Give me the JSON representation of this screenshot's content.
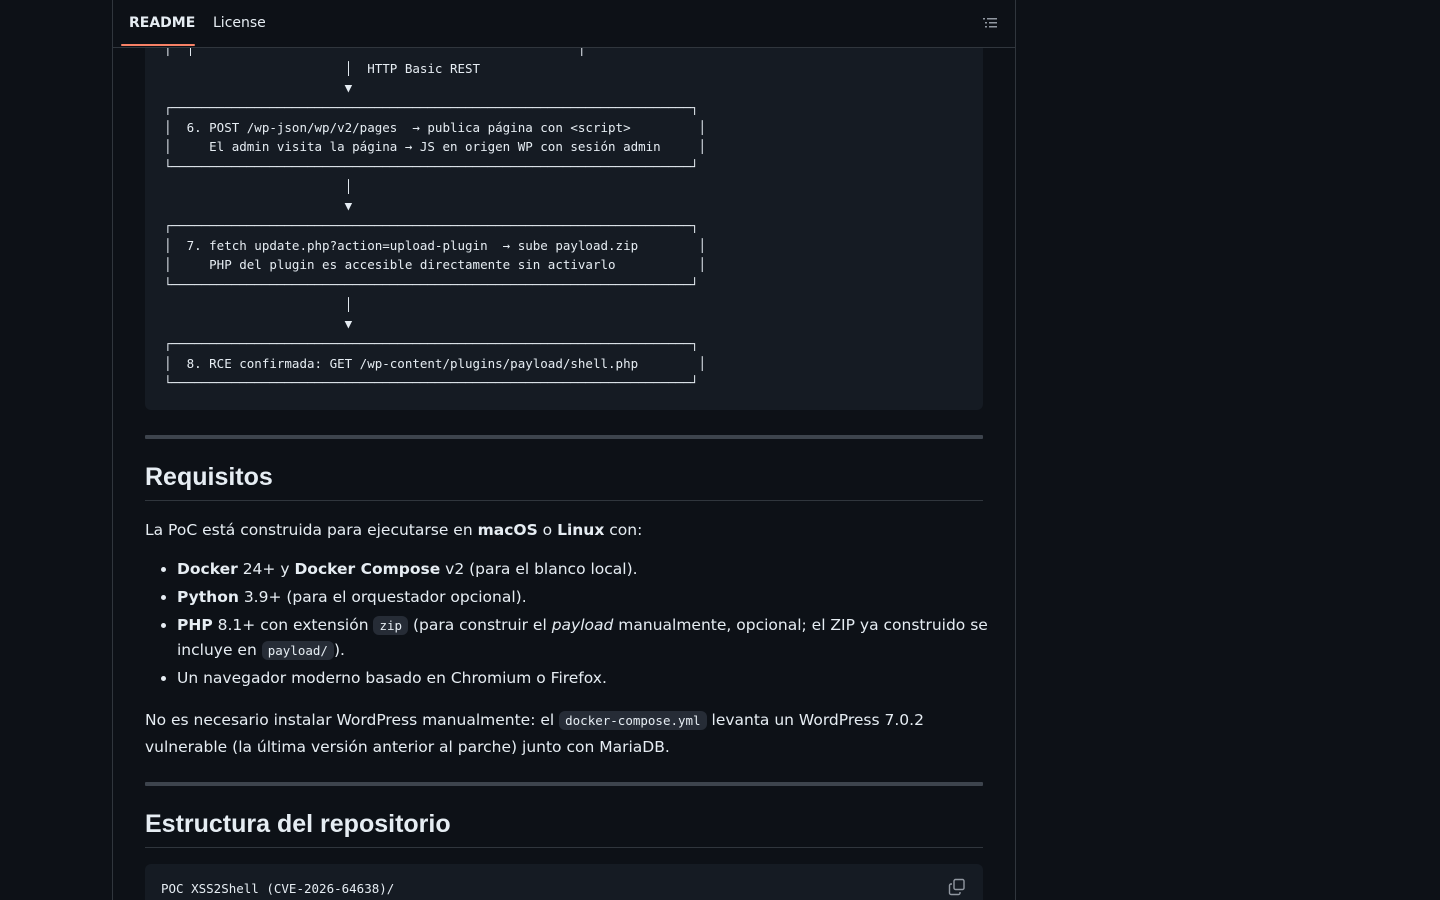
{
  "tabs": {
    "readme": "README",
    "license": "License"
  },
  "icons": {
    "outline": "list-outline-icon",
    "copy": "copy-icon"
  },
  "diagram_code": "│  │                                                   │\n                        │  HTTP Basic REST\n                        ▼\n┌─────────────────────────────────────────────────────────────────────┐\n│  6. POST /wp-json/wp/v2/pages  → publica página con <script>         │\n│     El admin visita la página → JS en origen WP con sesión admin     │\n└─────────────────────────────────────────────────────────────────────┘\n                        │\n                        ▼\n┌─────────────────────────────────────────────────────────────────────┐\n│  7. fetch update.php?action=upload-plugin  → sube payload.zip        │\n│     PHP del plugin es accesible directamente sin activarlo           │\n└─────────────────────────────────────────────────────────────────────┘\n                        │\n                        ▼\n┌─────────────────────────────────────────────────────────────────────┐\n│  8. RCE confirmada: GET /wp-content/plugins/payload/shell.php        │\n└─────────────────────────────────────────────────────────────────────┘",
  "requisitos": {
    "heading": "Requisitos",
    "intro": {
      "before": "La PoC está construida para ejecutarse en ",
      "b1": "macOS",
      "mid": " o ",
      "b2": "Linux",
      "after": " con:"
    },
    "items": [
      {
        "b1": "Docker",
        "t1": " 24+ y ",
        "b2": "Docker Compose",
        "t2": " v2 (para el blanco local)."
      },
      {
        "b1": "Python",
        "t1": " 3.9+ (para el orquestador opcional)."
      },
      {
        "b1": "PHP",
        "t1": " 8.1+ con extensión ",
        "code1": "zip",
        "t2": " (para construir el ",
        "em": "payload",
        "t3": " manualmente, opcional; el ZIP ya construido se incluye en ",
        "code2": "payload/",
        "t4": ")."
      },
      {
        "t1": "Un navegador moderno basado en Chromium o Firefox."
      }
    ],
    "note": {
      "before": "No es necesario instalar WordPress manualmente: el ",
      "code": "docker-compose.yml",
      "after": " levanta un WordPress 7.0.2 vulnerable (la última versión anterior al parche) junto con MariaDB."
    }
  },
  "estructura": {
    "heading": "Estructura del repositorio",
    "code": "POC XSS2Shell (CVE-2026-64638)/"
  }
}
